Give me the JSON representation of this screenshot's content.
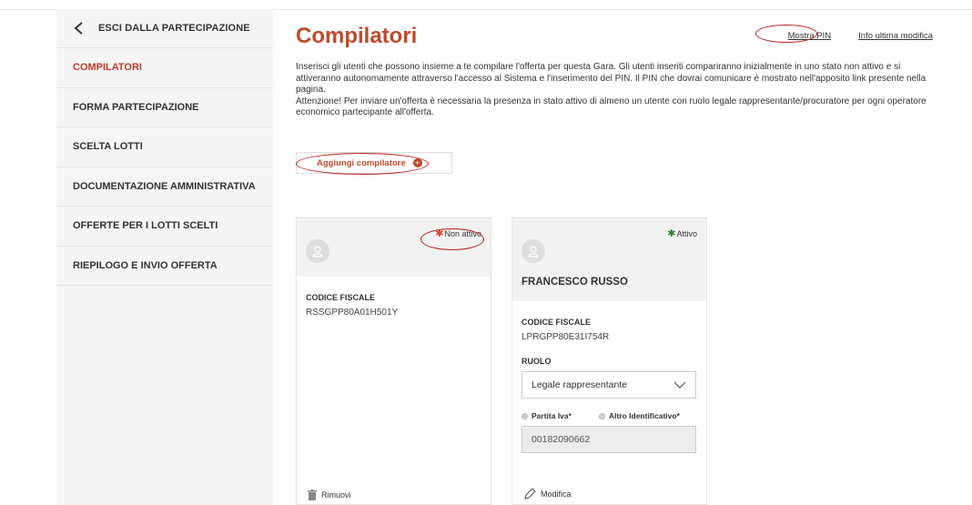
{
  "sidebar": {
    "back_label": "ESCI DALLA PARTECIPAZIONE",
    "items": [
      {
        "label": "COMPILATORI",
        "active": true
      },
      {
        "label": "FORMA PARTECIPAZIONE"
      },
      {
        "label": "SCELTA LOTTI"
      },
      {
        "label": "DOCUMENTAZIONE AMMINISTRATIVA"
      },
      {
        "label": "OFFERTE PER I LOTTI SCELTI"
      },
      {
        "label": "RIEPILOGO E INVIO OFFERTA"
      }
    ]
  },
  "header": {
    "title": "Compilatori",
    "show_pin_link": "Mostra PIN",
    "last_edit_link": "Info ultima modifica"
  },
  "description": {
    "paragraph1": "Inserisci gli utenti che possono insieme a te compilare l'offerta per questa Gara. Gli utenti inseriti compariranno inizialmente in uno stato non attivo e si attiveranno autonomamente attraverso l'accesso al Sistema e l'inserimento del PIN. Il PIN che dovrai comunicare è mostrato nell'apposito link presente nella pagina.",
    "paragraph2": "Attenzione! Per inviare un'offerta è necessaria la presenza in stato attivo di almeno un utente con ruolo legale rappresentante/procuratore per ogni operatore economico partecipante all'offerta."
  },
  "add_button_label": "Aggiungi compilatore",
  "cards": [
    {
      "status": "Non attivo",
      "status_color": "#e53935",
      "fiscal_code_label": "CODICE FISCALE",
      "fiscal_code": "RSSGPP80A01H501Y",
      "action_label": "Rimuovi"
    },
    {
      "status": "Attivo",
      "status_color": "#2e7d32",
      "name": "FRANCESCO RUSSO",
      "fiscal_code_label": "CODICE FISCALE",
      "fiscal_code": "LPRGPP80E31I754R",
      "role_label": "RUOLO",
      "role_value": "Legale rappresentante",
      "radio_vat": "Partita Iva*",
      "radio_other": "Altro Identificativo*",
      "vat_value": "00182090662",
      "action_label": "Modifica"
    }
  ],
  "colors": {
    "accent": "#bf4a2c",
    "annotation": "#b71c1c"
  }
}
